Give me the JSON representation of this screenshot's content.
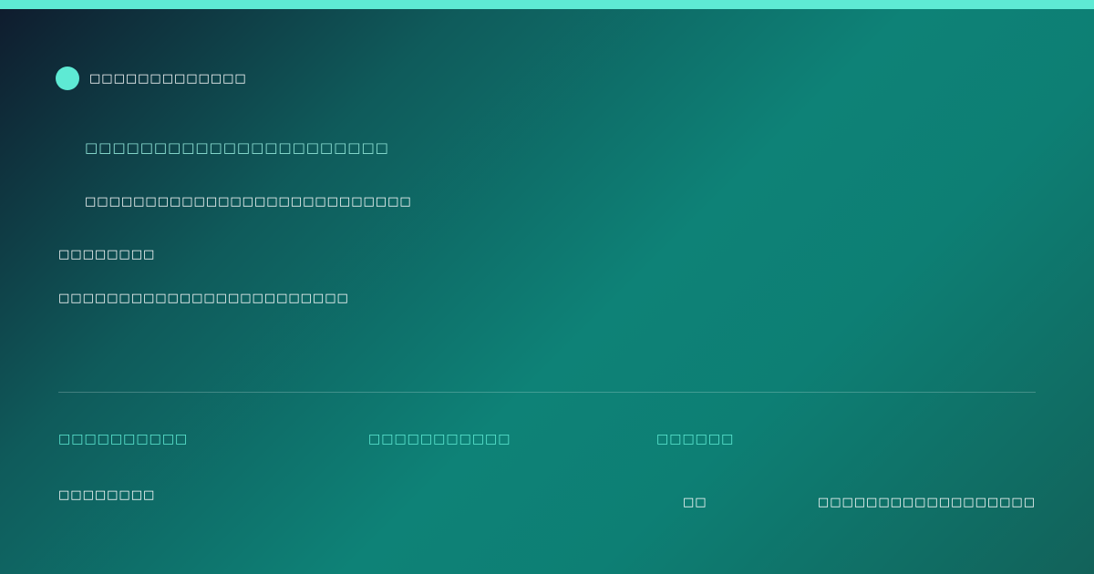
{
  "colors": {
    "accent": "#5eead4",
    "headline": "#8fe3d6",
    "text": "#ffffff"
  },
  "brand": {
    "icon": "circle-dot-icon",
    "name": "□□□□□□□□□□□□□"
  },
  "hero": {
    "headline": "□□□□□□□□□□□□□□□□□□□□□□",
    "subheadline": "□□□□□□□□□□□□□□□□□□□□□□□□□□□"
  },
  "section": {
    "label": "□□□□□□□□",
    "description": "□□□□□□□□□□□□□□□□□□□□□□□□"
  },
  "meta": {
    "item1": "□□□□□□□□□□",
    "item2": "□□□□□□□□□□□",
    "item3": "□□□□□□"
  },
  "footer": {
    "left": "□□□□□□□□",
    "mid": "□□",
    "right": "□□□□□□□□□□□□□□□□□□"
  }
}
